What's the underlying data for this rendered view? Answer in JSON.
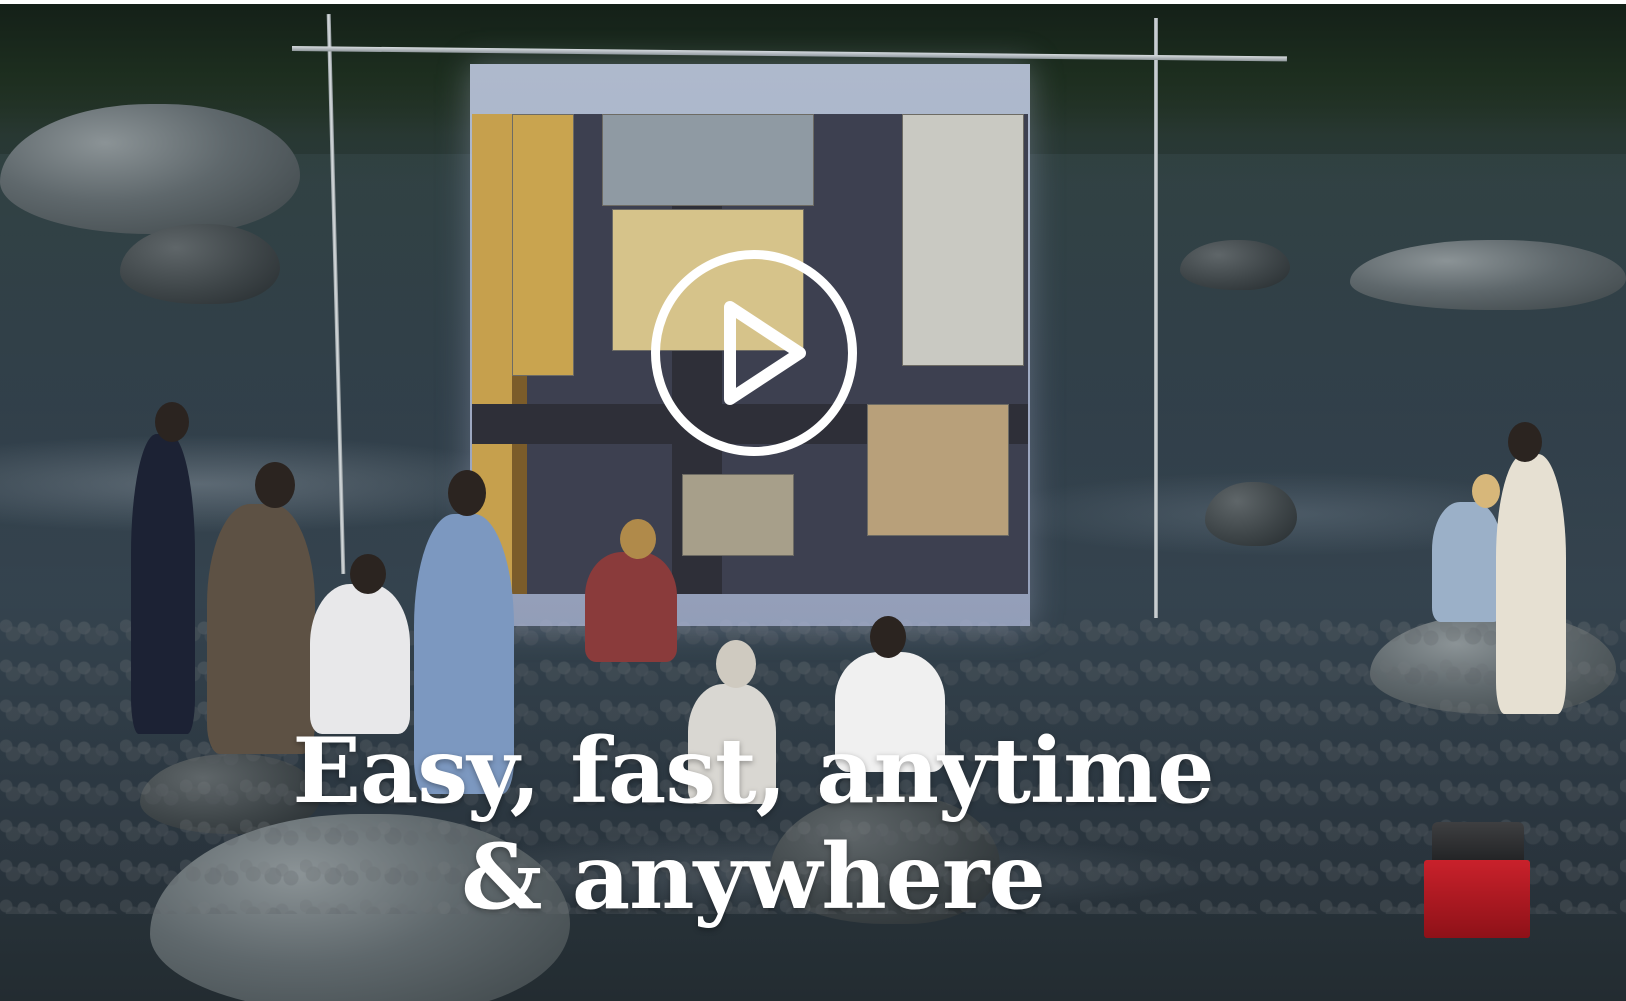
{
  "hero": {
    "headline_line1": "Easy, fast, anytime",
    "headline_line2": "& anywhere",
    "play_button_icon": "play-circle-icon",
    "colors": {
      "text": "#ffffff",
      "projector": "#c9212b"
    }
  }
}
